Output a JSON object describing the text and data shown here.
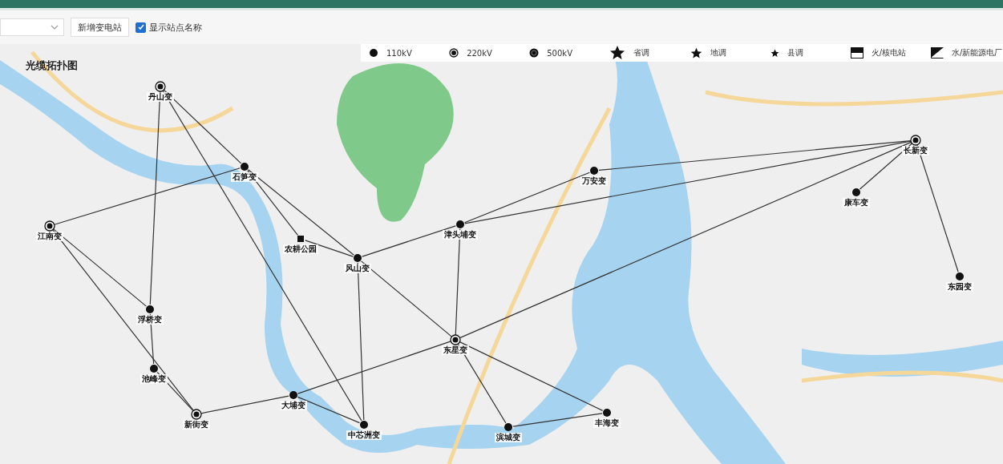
{
  "toolbar": {
    "add_button": "新增变电站",
    "show_names": {
      "label": "显示站点名称",
      "checked": true
    }
  },
  "map": {
    "title": "光缆拓扑图",
    "legend": [
      {
        "kind": "kv110",
        "label": "110kV"
      },
      {
        "kind": "kv220",
        "label": "220kV"
      },
      {
        "kind": "kv500",
        "label": "500kV"
      },
      {
        "kind": "provincial",
        "label": "省调"
      },
      {
        "kind": "prefectural",
        "label": "地调"
      },
      {
        "kind": "county",
        "label": "县调"
      },
      {
        "kind": "thermal",
        "label": "火/核电站"
      },
      {
        "kind": "hydro",
        "label": "水/新能源电厂"
      }
    ],
    "stations": [
      {
        "name": "丹山变",
        "kind": "kv220"
      },
      {
        "name": "石笋变",
        "kind": "kv110"
      },
      {
        "name": "江南变",
        "kind": "kv220"
      },
      {
        "name": "浮桥变",
        "kind": "kv110"
      },
      {
        "name": "池峰变",
        "kind": "kv110"
      },
      {
        "name": "风山变",
        "kind": "kv110"
      },
      {
        "name": "津头埔变",
        "kind": "kv110"
      },
      {
        "name": "东星变",
        "kind": "kv220"
      },
      {
        "name": "万安变",
        "kind": "kv110"
      },
      {
        "name": "长新变",
        "kind": "kv220"
      },
      {
        "name": "康车变",
        "kind": "kv110"
      },
      {
        "name": "东园变",
        "kind": "kv110"
      },
      {
        "name": "中芯洲变",
        "kind": "kv110"
      },
      {
        "name": "滨城变",
        "kind": "kv110"
      },
      {
        "name": "丰海变",
        "kind": "kv110"
      },
      {
        "name": "大埔变",
        "kind": "kv110"
      },
      {
        "name": "新街变",
        "kind": "kv220"
      },
      {
        "name": "农耕公园",
        "kind": "plant"
      }
    ]
  }
}
